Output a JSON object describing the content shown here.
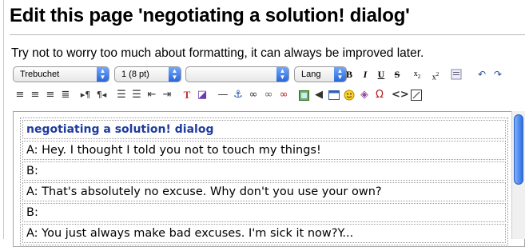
{
  "page": {
    "title": "Edit this page 'negotiating a solution! dialog'",
    "hint": "Try not to worry too much about formatting, it can always be improved later."
  },
  "toolbar": {
    "font_family": "Trebuchet",
    "font_size": "1 (8 pt)",
    "format_block": "",
    "language": "Lang",
    "row1_icons": [
      "bold-icon",
      "italic-icon",
      "underline-icon",
      "strikethrough-icon",
      "subscript-icon",
      "superscript-icon",
      "paste-word-icon",
      "undo-icon",
      "redo-icon"
    ],
    "row2_icons": [
      "align-left-icon",
      "align-center-icon",
      "align-right-icon",
      "justify-icon",
      "ltr-icon",
      "rtl-icon",
      "ordered-list-icon",
      "unordered-list-icon",
      "outdent-icon",
      "indent-icon",
      "text-color-icon",
      "background-color-icon",
      "horizontal-rule-icon",
      "anchor-icon",
      "link-icon",
      "nolink-icon",
      "unlink-icon",
      "image-icon",
      "media-icon",
      "table-icon",
      "smiley-icon",
      "insert-plugin-icon",
      "character-map-icon",
      "html-source-icon",
      "fullscreen-icon"
    ]
  },
  "editor": {
    "table_title": "negotiating a solution! dialog",
    "rows": [
      "A: Hey. I thought I told you not to touch my things!",
      "B:",
      "A: That's absolutely no excuse. Why don't you use your own?",
      "B:",
      "A: You just always make bad excuses. I'm sick it now?Y..."
    ]
  },
  "colors": {
    "accent": "#2a67d8",
    "title_link": "#1f3c9e"
  }
}
